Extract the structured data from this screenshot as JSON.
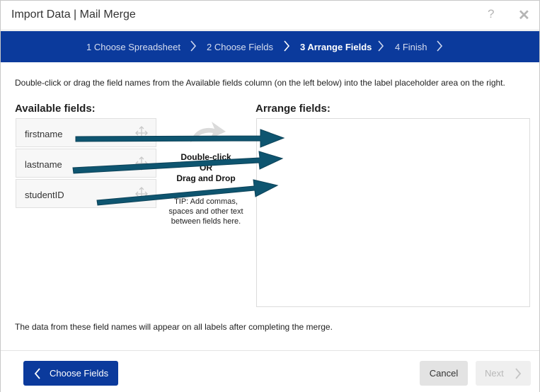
{
  "window": {
    "title": "Import Data | Mail Merge",
    "help_glyph": "?",
    "close_glyph": "✕"
  },
  "steps": [
    {
      "label": "1 Choose Spreadsheet",
      "active": false
    },
    {
      "label": "2 Choose Fields",
      "active": false
    },
    {
      "label": "3 Arrange Fields",
      "active": true
    },
    {
      "label": "4 Finish",
      "active": false
    }
  ],
  "instructions": "Double-click or drag the field names from the Available fields column (on the left below) into the label placeholder area on the right.",
  "available": {
    "heading": "Available fields:",
    "fields": [
      "firstname",
      "lastname",
      "studentID"
    ]
  },
  "hint": {
    "line1": "Double-click",
    "line2": "OR",
    "line3": "Drag and Drop",
    "tip": "TIP: Add commas, spaces and other text between fields here."
  },
  "arrange": {
    "heading": "Arrange fields:"
  },
  "note": "The data from these field names will appear on all labels after completing the merge.",
  "footer": {
    "back_label": "Choose Fields",
    "cancel_label": "Cancel",
    "next_label": "Next"
  },
  "colors": {
    "brand_blue": "#0b3a9c",
    "annotation_arrow": "#0e5570"
  },
  "icons": [
    "help-icon",
    "close-icon",
    "chevron-right-icon",
    "move-icon",
    "curved-arrow-icon",
    "chevron-left-icon"
  ]
}
